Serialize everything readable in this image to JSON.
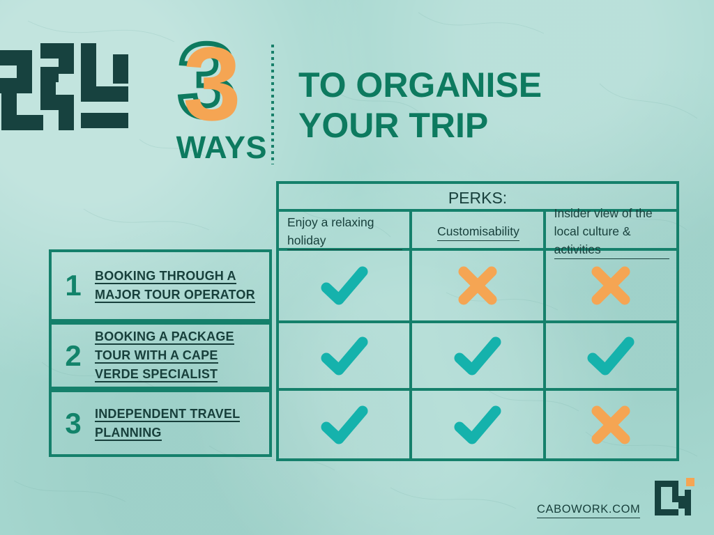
{
  "meta": {
    "background_color": "#a7d8d0",
    "accent_green": "#0d7a5f",
    "border_green": "#15806b",
    "dark_text": "#173f3b",
    "orange": "#f5a553",
    "teal_check": "#15b2ac"
  },
  "header": {
    "logo_name": "cabowork-maze-logo",
    "count": "3",
    "count_word": "WAYS",
    "title_line1": "TO ORGANISE",
    "title_line2": "YOUR TRIP",
    "divider_name": "dotted-vertical-divider"
  },
  "table": {
    "perks_title": "PERKS:",
    "columns": [
      {
        "label": "Enjoy a relaxing holiday",
        "align": "left"
      },
      {
        "label": "Customisability",
        "align": "center"
      },
      {
        "label": "Insider view of the local culture & activities",
        "align": "left"
      }
    ],
    "rows": [
      {
        "number": "1",
        "label_lines": [
          "BOOKING THROUGH A",
          "MAJOR TOUR OPERATOR"
        ],
        "marks": [
          "check",
          "cross",
          "cross"
        ]
      },
      {
        "number": "2",
        "label_lines": [
          "BOOKING A PACKAGE",
          "TOUR WITH A CAPE",
          "VERDE SPECIALIST"
        ],
        "marks": [
          "check",
          "check",
          "check"
        ]
      },
      {
        "number": "3",
        "label_lines": [
          "INDEPENDENT TRAVEL",
          "PLANNING"
        ],
        "marks": [
          "check",
          "check",
          "cross"
        ]
      }
    ]
  },
  "footer": {
    "url": "CABOWORK.COM",
    "logo_name": "cabowork-corner-logo"
  }
}
